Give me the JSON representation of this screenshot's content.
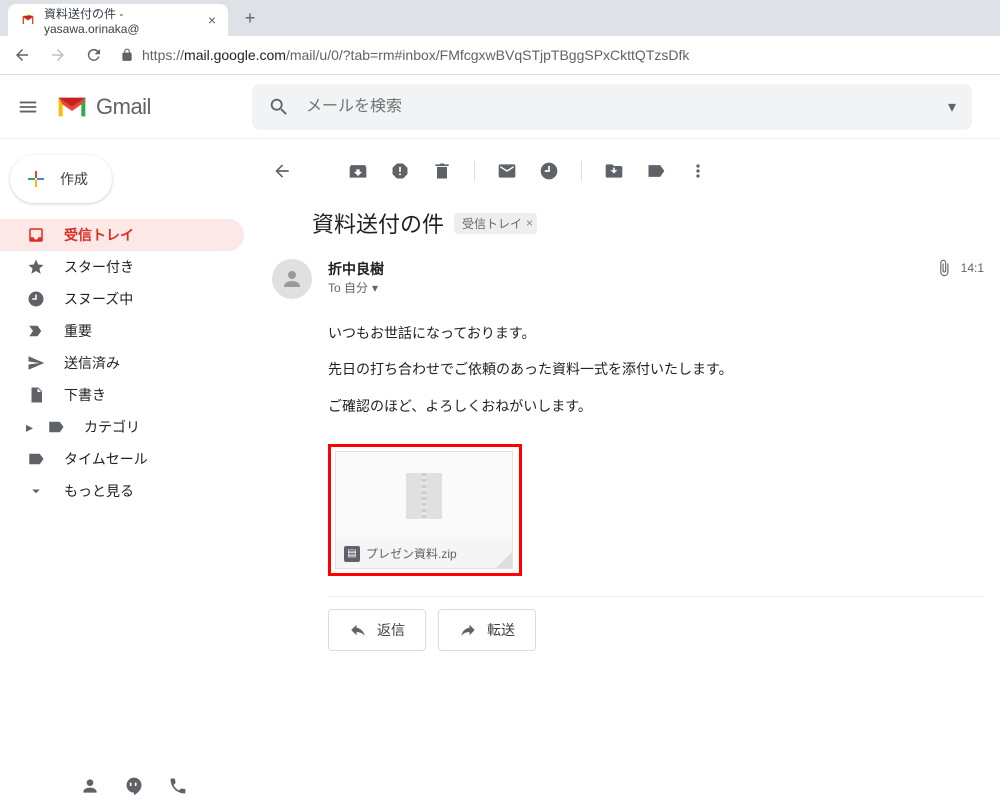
{
  "browser": {
    "tab_title": "資料送付の件 - yasawa.orinaka@",
    "url_prefix": "https://",
    "url_domain": "mail.google.com",
    "url_path": "/mail/u/0/?tab=rm#inbox/FMfcgxwBVqSTjpTBggSPxCkttQTzsDfk"
  },
  "header": {
    "app_name": "Gmail",
    "search_placeholder": "メールを検索"
  },
  "compose_label": "作成",
  "sidebar": {
    "items": [
      {
        "label": "受信トレイ"
      },
      {
        "label": "スター付き"
      },
      {
        "label": "スヌーズ中"
      },
      {
        "label": "重要"
      },
      {
        "label": "送信済み"
      },
      {
        "label": "下書き"
      },
      {
        "label": "カテゴリ"
      },
      {
        "label": "タイムセール"
      },
      {
        "label": "もっと見る"
      }
    ]
  },
  "email": {
    "subject": "資料送付の件",
    "inbox_chip": "受信トレイ",
    "sender_name": "折中良樹",
    "to_line": "To 自分",
    "time": "14:1",
    "body_lines": [
      "いつもお世話になっております。",
      "先日の打ち合わせでご依頼のあった資料一式を添付いたします。",
      "ご確認のほど、よろしくおねがいします。"
    ],
    "attachment_name": "プレゼン資料.zip",
    "reply_label": "返信",
    "forward_label": "転送"
  }
}
